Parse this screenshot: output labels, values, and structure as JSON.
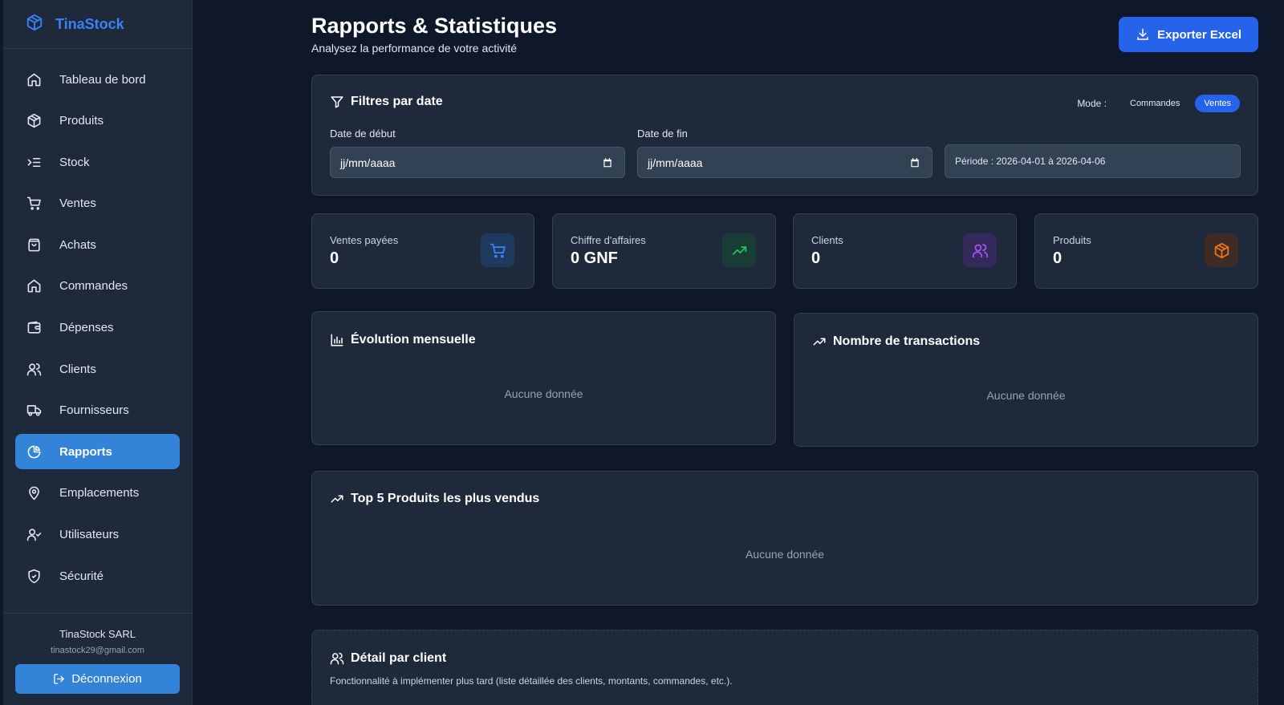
{
  "brand": {
    "name": "TinaStock"
  },
  "sidebar": {
    "items": [
      {
        "label": "Tableau de bord",
        "icon": "home-icon"
      },
      {
        "label": "Produits",
        "icon": "box-icon"
      },
      {
        "label": "Stock",
        "icon": "list-indent-icon"
      },
      {
        "label": "Ventes",
        "icon": "cart-icon"
      },
      {
        "label": "Achats",
        "icon": "shopping-bag-icon"
      },
      {
        "label": "Commandes",
        "icon": "home-icon"
      },
      {
        "label": "Dépenses",
        "icon": "wallet-icon"
      },
      {
        "label": "Clients",
        "icon": "users-icon"
      },
      {
        "label": "Fournisseurs",
        "icon": "truck-icon"
      },
      {
        "label": "Rapports",
        "icon": "pie-chart-icon",
        "active": true
      },
      {
        "label": "Emplacements",
        "icon": "map-pin-icon"
      },
      {
        "label": "Utilisateurs",
        "icon": "user-check-icon"
      },
      {
        "label": "Sécurité",
        "icon": "shield-icon"
      }
    ],
    "footer": {
      "company": "TinaStock SARL",
      "email": "tinastock29@gmail.com",
      "logout_label": "Déconnexion"
    }
  },
  "header": {
    "title": "Rapports & Statistiques",
    "subtitle": "Analysez la performance de votre activité",
    "export_label": "Exporter Excel"
  },
  "filters": {
    "title": "Filtres par date",
    "mode_label": "Mode :",
    "modes": [
      "Commandes",
      "Ventes"
    ],
    "active_mode": "Ventes",
    "start_label": "Date de début",
    "start_value": "jj/mm/aaaa",
    "end_label": "Date de fin",
    "end_value": "jj/mm/aaaa",
    "periode": "Période : 2026-04-01 à 2026-04-06"
  },
  "stats": [
    {
      "label": "Ventes payées",
      "value": "0",
      "icon": "cart-icon",
      "color": "#3b82f6"
    },
    {
      "label": "Chiffre d'affaires",
      "value": "0 GNF",
      "icon": "trending-up-icon",
      "color": "#22c55e"
    },
    {
      "label": "Clients",
      "value": "0",
      "icon": "users-icon",
      "color": "#a855f7"
    },
    {
      "label": "Produits",
      "value": "0",
      "icon": "box-icon",
      "color": "#f97316"
    }
  ],
  "charts": {
    "monthly": {
      "title": "Évolution mensuelle",
      "empty": "Aucune donnée"
    },
    "transactions": {
      "title": "Nombre de transactions",
      "empty": "Aucune donnée"
    },
    "top_products": {
      "title": "Top 5 Produits les plus vendus",
      "empty": "Aucune donnée"
    }
  },
  "detail": {
    "title": "Détail par client",
    "text": "Fonctionnalité à implémenter plus tard (liste détaillée des clients, montants, commandes, etc.)."
  },
  "colors": {
    "accent": "#2563eb",
    "sidebar_active": "#3384d9",
    "background": "#0f172a",
    "card": "#1e293b"
  }
}
